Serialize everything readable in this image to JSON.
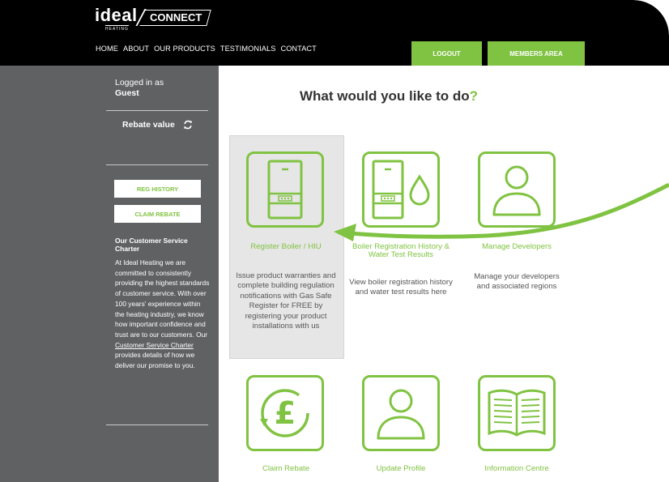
{
  "header": {
    "logo_word": "ideal",
    "logo_sub": "HEATING",
    "logo_connect": "CONNECT",
    "nav": [
      "HOME",
      "ABOUT",
      "OUR PRODUCTS",
      "TESTIMONIALS",
      "CONTACT"
    ],
    "logout_label": "LOGOUT",
    "members_label": "MEMBERS AREA"
  },
  "sidebar": {
    "logged_in_label": "Logged in as",
    "user": "Guest",
    "rebate_label": "Rebate value",
    "reg_history_label": "REG HISTORY",
    "claim_rebate_label": "CLAIM REBATE",
    "charter_title": "Our Customer Service Charter",
    "charter_text_1": "At Ideal Heating we are committed to consistently providing the highest standards of customer service. With over 100 years' experience within the heating industry, we know how important confidence and trust are to our customers. Our ",
    "charter_link": "Customer Service Charter",
    "charter_text_2": " provides details of how we deliver our promise to you."
  },
  "main": {
    "title": "What would you like to do",
    "title_mark": "?",
    "tiles": [
      {
        "label": "Register Boiler / HIU",
        "desc": "Issue product warranties and complete building regulation notifications with Gas Safe Register for FREE by registering your product installations with us",
        "icon": "boiler-icon"
      },
      {
        "label": "Boiler Registration History & Water Test Results",
        "desc": "View boiler registration history and water test results here",
        "icon": "boiler-water-icon"
      },
      {
        "label": "Manage Developers",
        "desc": "Manage your developers and associated regions",
        "icon": "user-icon"
      },
      {
        "label": "Claim Rebate",
        "desc": "",
        "icon": "pound-rebate-icon"
      },
      {
        "label": "Update Profile",
        "desc": "",
        "icon": "user-icon"
      },
      {
        "label": "Information Centre",
        "desc": "",
        "icon": "book-icon"
      }
    ]
  },
  "colors": {
    "brand_green": "#80c342",
    "sidebar_grey": "#5f6163",
    "header_black": "#000000"
  }
}
